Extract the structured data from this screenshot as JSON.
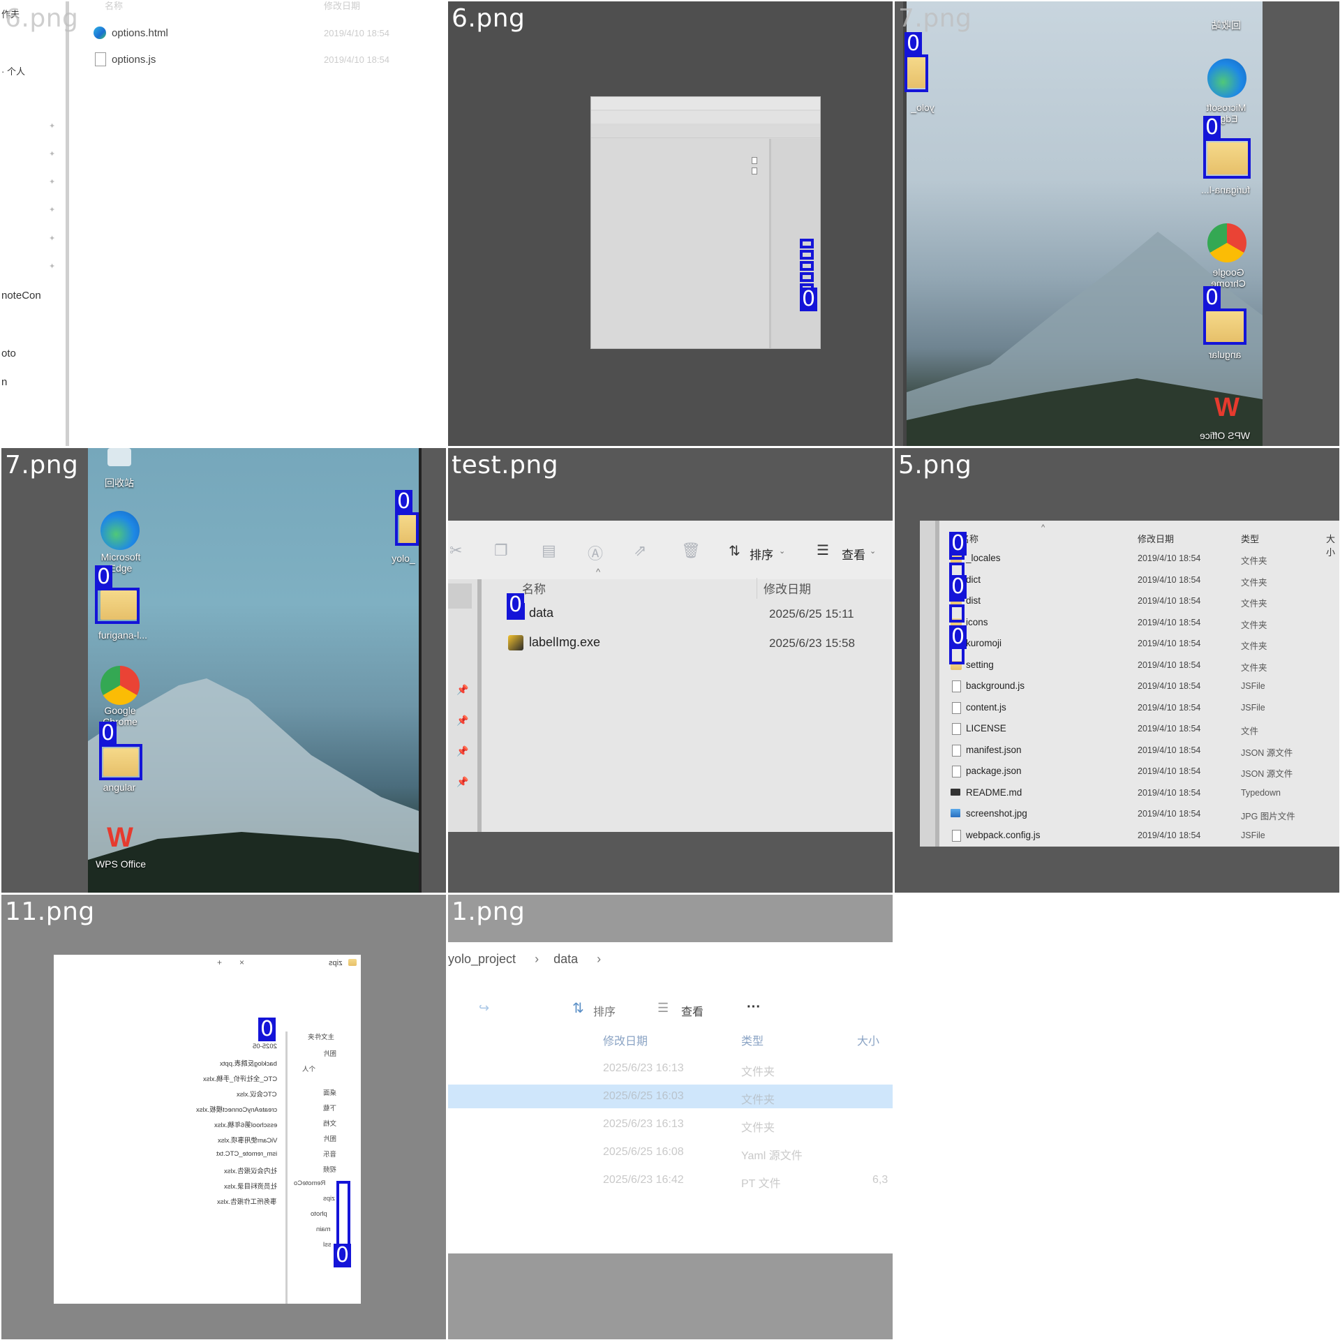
{
  "tiles": {
    "t1": {
      "label": "6.png",
      "items": [
        "options.html",
        "options.js"
      ],
      "dates": [
        "2019/4/10 18:54",
        "2019/4/10 18:54"
      ],
      "sidebar": [
        "作夫",
        "· 个人",
        "noteCon",
        "oto",
        "n"
      ],
      "header": [
        "名称",
        "修改日期"
      ]
    },
    "t2": {
      "label": "6.png"
    },
    "t3": {
      "label": "7.png",
      "icons": [
        "回收站",
        "Microsoft Edge",
        "furigana-l...",
        "Google Chrome",
        "angular",
        "WPS Office",
        "yolo_"
      ]
    },
    "t4": {
      "label": "7.png",
      "icons": [
        "回收站",
        "Microsoft Edge",
        "furigana-l...",
        "Google Chrome",
        "angular",
        "WPS Office",
        "yolo_"
      ]
    },
    "t5": {
      "label": "test.png",
      "toolbar": {
        "sort": "排序",
        "view": "查看"
      },
      "header": {
        "name": "名称",
        "date": "修改日期"
      },
      "rows": [
        {
          "name": "data",
          "date": "2025/6/25 15:11"
        },
        {
          "name": "labelImg.exe",
          "date": "2025/6/23 15:58"
        }
      ]
    },
    "t6": {
      "label": "5.png",
      "header": {
        "name": "名称",
        "date": "修改日期",
        "type": "类型",
        "size": "大小"
      },
      "rows": [
        {
          "name": "_locales",
          "date": "2019/4/10 18:54",
          "type": "文件夹"
        },
        {
          "name": "dict",
          "date": "2019/4/10 18:54",
          "type": "文件夹"
        },
        {
          "name": "dist",
          "date": "2019/4/10 18:54",
          "type": "文件夹"
        },
        {
          "name": "icons",
          "date": "2019/4/10 18:54",
          "type": "文件夹"
        },
        {
          "name": "kuromoji",
          "date": "2019/4/10 18:54",
          "type": "文件夹"
        },
        {
          "name": "setting",
          "date": "2019/4/10 18:54",
          "type": "文件夹"
        },
        {
          "name": "background.js",
          "date": "2019/4/10 18:54",
          "type": "JSFile"
        },
        {
          "name": "content.js",
          "date": "2019/4/10 18:54",
          "type": "JSFile"
        },
        {
          "name": "LICENSE",
          "date": "2019/4/10 18:54",
          "type": "文件"
        },
        {
          "name": "manifest.json",
          "date": "2019/4/10 18:54",
          "type": "JSON 源文件"
        },
        {
          "name": "package.json",
          "date": "2019/4/10 18:54",
          "type": "JSON 源文件"
        },
        {
          "name": "README.md",
          "date": "2019/4/10 18:54",
          "type": "Typedown"
        },
        {
          "name": "screenshot.jpg",
          "date": "2019/4/10 18:54",
          "type": "JPG 图片文件"
        },
        {
          "name": "webpack.config.js",
          "date": "2019/4/10 18:54",
          "type": "JSFile"
        }
      ]
    },
    "t7": {
      "label": "11.png",
      "rows": [
        "2025-05",
        "backlog反跳表.pptx",
        "CTC_全社评价_手稿.xlsx",
        "CTC会议.xlsx",
        "createAnyConnect模板.xlsx",
        "esschool第6年稿.xlsx",
        "ViCam使用事项.xlsx",
        "ism_remote_CTC.txt",
        "社内会议报告.xlsx",
        "社员资料目录.xlsx",
        "事务所工作报告.xlsx"
      ],
      "side": [
        "主文件夹",
        "图片",
        "个人",
        "桌面",
        "下载",
        "文档",
        "图片",
        "音乐",
        "视频",
        "RemoteCo",
        "zips",
        "photo",
        "main",
        "ssl"
      ],
      "header": "zips"
    },
    "t8": {
      "label": "1.png",
      "crumbs": [
        "yolo_project",
        "data"
      ],
      "toolbar": {
        "sort": "排序",
        "view": "查看",
        "more": "···"
      },
      "header": {
        "date": "修改日期",
        "type": "类型",
        "size": "大小"
      },
      "rows": [
        {
          "date": "2025/6/23 16:13",
          "type": "文件夹",
          "size": ""
        },
        {
          "date": "2025/6/25 16:03",
          "type": "文件夹",
          "size": ""
        },
        {
          "date": "2025/6/23 16:13",
          "type": "文件夹",
          "size": ""
        },
        {
          "date": "2025/6/25 16:08",
          "type": "Yaml 源文件",
          "size": ""
        },
        {
          "date": "2025/6/23 16:42",
          "type": "PT 文件",
          "size": "6,3"
        }
      ]
    }
  },
  "box_label": "0",
  "colors": {
    "box": "#1414d8",
    "sel": "#cfe6fb"
  }
}
